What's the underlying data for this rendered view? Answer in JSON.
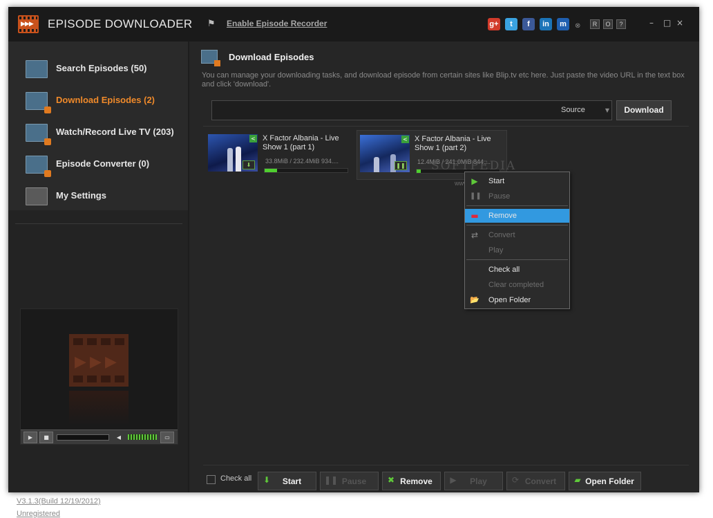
{
  "app": {
    "title": "EPISODE DOWNLOADER",
    "recorder_link": "Enable Episode Recorder"
  },
  "social": [
    {
      "name": "google-plus-icon",
      "glyph": "g+",
      "color": "#d23b2b"
    },
    {
      "name": "twitter-icon",
      "glyph": "t",
      "color": "#3aa2e0"
    },
    {
      "name": "facebook-icon",
      "glyph": "f",
      "color": "#3b5998"
    },
    {
      "name": "linkedin-icon",
      "glyph": "in",
      "color": "#1b74b8"
    },
    {
      "name": "myspace-icon",
      "glyph": "m",
      "color": "#1f5fb0"
    }
  ],
  "header_buttons": [
    "R",
    "O",
    "?"
  ],
  "window_controls": [
    "–",
    "□",
    "×"
  ],
  "sidebar": {
    "items": [
      {
        "label": "Search Episodes  (50)",
        "active": false
      },
      {
        "label": "Download Episodes  (2)",
        "active": true
      },
      {
        "label": "Watch/Record Live TV  (203)",
        "active": false
      },
      {
        "label": "Episode Converter  (0)",
        "active": false
      },
      {
        "label": "My Settings",
        "active": false
      }
    ],
    "version": "V3.1.3(Build 12/19/2012)",
    "registration": "Unregistered"
  },
  "main": {
    "title": "Download Episodes",
    "description": "You can manage your downloading tasks, and download episode from certain sites like Blip.tv etc here. Just paste the video URL in the text box and click 'download'.",
    "url_value": "",
    "source_label": "Source",
    "download_label": "Download"
  },
  "downloads": [
    {
      "title": "X Factor Albania - Live Show 1 (part 1)",
      "size": "33.8MiB / 232.4MiB 934....",
      "progress": 0.15,
      "state_glyph": "⬇"
    },
    {
      "title": "X Factor Albania - Live Show 1 (part 2)",
      "size": "12.4MiB / 241.0MiB 844....",
      "progress": 0.05,
      "state_glyph": "❚❚"
    }
  ],
  "watermark": {
    "text": "SOFTPEDIA",
    "sub": "www.softpedia.com"
  },
  "context_menu": [
    {
      "label": "Start",
      "icon": "▶",
      "disabled": false,
      "highlight": false,
      "color": "#5fc93a"
    },
    {
      "label": "Pause",
      "icon": "❚❚",
      "disabled": true,
      "highlight": false,
      "color": "#6e6e6e"
    },
    {
      "label": "Remove",
      "icon": "▬",
      "disabled": false,
      "highlight": true,
      "color": "#e0283a"
    },
    {
      "label": "Convert",
      "icon": "⇄",
      "disabled": true,
      "highlight": false,
      "color": "#8a8a8a"
    },
    {
      "label": "Play",
      "icon": "",
      "disabled": true,
      "highlight": false,
      "color": "#6e6e6e"
    },
    {
      "label": "Check all",
      "icon": "",
      "disabled": false,
      "highlight": false,
      "color": "#e6e6e6"
    },
    {
      "label": "Clear completed",
      "icon": "",
      "disabled": true,
      "highlight": false,
      "color": "#6e6e6e"
    },
    {
      "label": "Open Folder",
      "icon": "📂",
      "disabled": false,
      "highlight": false,
      "color": "#e0b030"
    }
  ],
  "bottom": {
    "check_all": "Check all",
    "buttons": [
      {
        "label": "Start",
        "icon": "⬇",
        "disabled": false,
        "color": "#5fc93a"
      },
      {
        "label": "Pause",
        "icon": "❚❚",
        "disabled": true,
        "color": "#555"
      },
      {
        "label": "Remove",
        "icon": "✖",
        "disabled": false,
        "color": "#5fc93a"
      },
      {
        "label": "Play",
        "icon": "▶",
        "disabled": true,
        "color": "#555"
      },
      {
        "label": "Convert",
        "icon": "⟳",
        "disabled": true,
        "color": "#555"
      },
      {
        "label": "Open Folder",
        "icon": "▰",
        "disabled": false,
        "color": "#5fc93a"
      }
    ]
  }
}
